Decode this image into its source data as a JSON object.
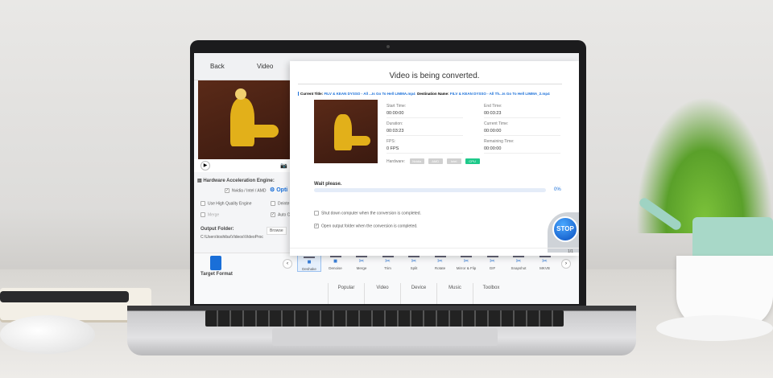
{
  "app": {
    "back_label": "Back",
    "video_tab": "Video"
  },
  "left_panel": {
    "hw_engine_label": "Hardware Acceleration Engine:",
    "hw_option": "Nvidia / Intel / AMD",
    "option_label": "Opti",
    "high_quality": "Use High Quality Engine",
    "deinterlace": "Deinte",
    "merge": "Merge",
    "auto": "Auto C",
    "output_folder_label": "Output Folder:",
    "output_path": "C:\\Users\\toshiba\\Videos\\VideoProc",
    "browse": "Browse",
    "target_format": "Target Format"
  },
  "dialog": {
    "title": "Video is being converted.",
    "current_title_label": "Current Title:",
    "current_title": "FILV & KEAN DYSSO - All ...Is Go To Hell LIMMA.mp4",
    "destination_label": "Destination Name:",
    "destination": "FILV & KEAN DYSSO - All Th...Is Go To Hell LIMMA_2.mp4",
    "fields": [
      {
        "label": "Start Time:",
        "value": "00:00:00"
      },
      {
        "label": "End Time:",
        "value": "00:03:23"
      },
      {
        "label": "Duration:",
        "value": "00:03:23"
      },
      {
        "label": "Current Time:",
        "value": "00:00:00"
      },
      {
        "label": "FPS:",
        "value": "0 FPS"
      },
      {
        "label": "Remaining Time:",
        "value": "00:00:00"
      }
    ],
    "hardware_label": "Hardware:",
    "hardware": [
      "Nvidia",
      "AMD",
      "Intel",
      "CPU"
    ],
    "hardware_active_color": "#1ec98a",
    "wait": "Wait please.",
    "progress_percent": 0,
    "progress_text": "0%",
    "shutdown": "Shut down computer when the conversion is completed.",
    "open_folder": "Open output folder when the conversion is completed.",
    "stop": "STOP",
    "page": "1/1"
  },
  "toolbar": {
    "tools": [
      "Deshake",
      "Denoise",
      "Merge",
      "Trim",
      "Split",
      "Rotate",
      "Mirror & Flip",
      "GIF",
      "Snapshot",
      "MKVB"
    ]
  },
  "tabs": [
    "Popular",
    "Video",
    "Device",
    "Music",
    "Toolbox"
  ]
}
